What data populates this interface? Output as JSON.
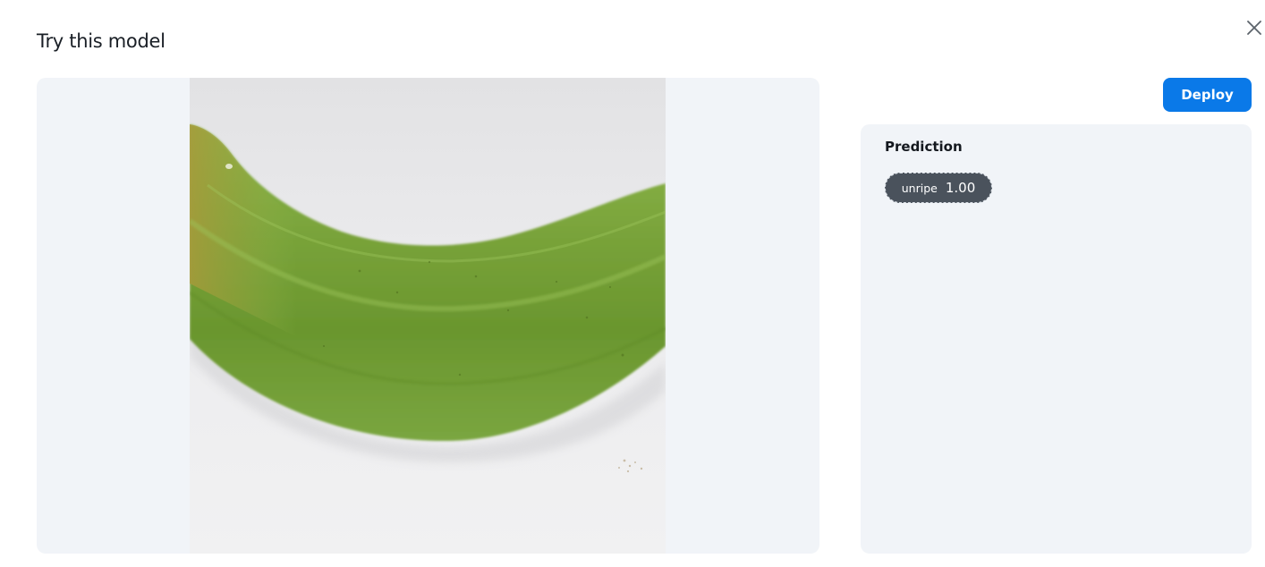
{
  "dialog": {
    "title": "Try this model",
    "close_icon": "close-icon"
  },
  "image": {
    "subject": "green unripe banana on white background"
  },
  "actions": {
    "deploy_label": "Deploy",
    "deploy_color": "#0a79e8"
  },
  "prediction": {
    "title": "Prediction",
    "label": "unripe",
    "score": "1.00"
  },
  "colors": {
    "panel_background": "#f1f4f8",
    "chip_background": "#4a525c"
  }
}
